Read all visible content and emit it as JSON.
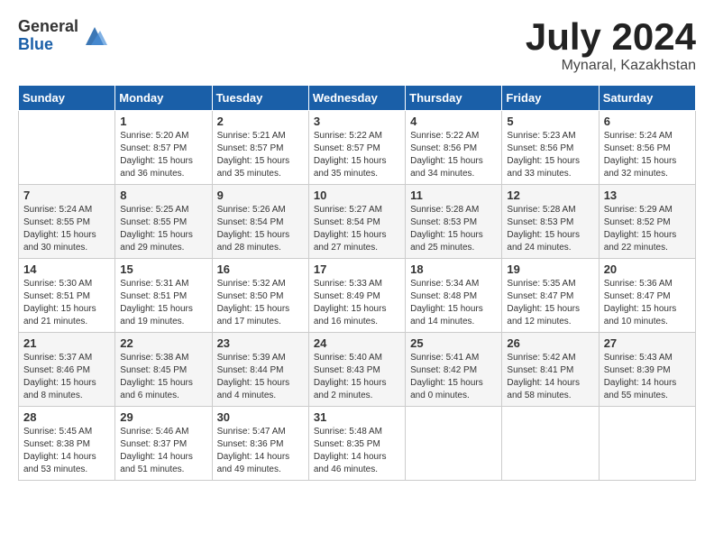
{
  "logo": {
    "general": "General",
    "blue": "Blue"
  },
  "title": "July 2024",
  "location": "Mynaral, Kazakhstan",
  "days_header": [
    "Sunday",
    "Monday",
    "Tuesday",
    "Wednesday",
    "Thursday",
    "Friday",
    "Saturday"
  ],
  "weeks": [
    [
      {
        "day": "",
        "info": ""
      },
      {
        "day": "1",
        "info": "Sunrise: 5:20 AM\nSunset: 8:57 PM\nDaylight: 15 hours\nand 36 minutes."
      },
      {
        "day": "2",
        "info": "Sunrise: 5:21 AM\nSunset: 8:57 PM\nDaylight: 15 hours\nand 35 minutes."
      },
      {
        "day": "3",
        "info": "Sunrise: 5:22 AM\nSunset: 8:57 PM\nDaylight: 15 hours\nand 35 minutes."
      },
      {
        "day": "4",
        "info": "Sunrise: 5:22 AM\nSunset: 8:56 PM\nDaylight: 15 hours\nand 34 minutes."
      },
      {
        "day": "5",
        "info": "Sunrise: 5:23 AM\nSunset: 8:56 PM\nDaylight: 15 hours\nand 33 minutes."
      },
      {
        "day": "6",
        "info": "Sunrise: 5:24 AM\nSunset: 8:56 PM\nDaylight: 15 hours\nand 32 minutes."
      }
    ],
    [
      {
        "day": "7",
        "info": "Sunrise: 5:24 AM\nSunset: 8:55 PM\nDaylight: 15 hours\nand 30 minutes."
      },
      {
        "day": "8",
        "info": "Sunrise: 5:25 AM\nSunset: 8:55 PM\nDaylight: 15 hours\nand 29 minutes."
      },
      {
        "day": "9",
        "info": "Sunrise: 5:26 AM\nSunset: 8:54 PM\nDaylight: 15 hours\nand 28 minutes."
      },
      {
        "day": "10",
        "info": "Sunrise: 5:27 AM\nSunset: 8:54 PM\nDaylight: 15 hours\nand 27 minutes."
      },
      {
        "day": "11",
        "info": "Sunrise: 5:28 AM\nSunset: 8:53 PM\nDaylight: 15 hours\nand 25 minutes."
      },
      {
        "day": "12",
        "info": "Sunrise: 5:28 AM\nSunset: 8:53 PM\nDaylight: 15 hours\nand 24 minutes."
      },
      {
        "day": "13",
        "info": "Sunrise: 5:29 AM\nSunset: 8:52 PM\nDaylight: 15 hours\nand 22 minutes."
      }
    ],
    [
      {
        "day": "14",
        "info": "Sunrise: 5:30 AM\nSunset: 8:51 PM\nDaylight: 15 hours\nand 21 minutes."
      },
      {
        "day": "15",
        "info": "Sunrise: 5:31 AM\nSunset: 8:51 PM\nDaylight: 15 hours\nand 19 minutes."
      },
      {
        "day": "16",
        "info": "Sunrise: 5:32 AM\nSunset: 8:50 PM\nDaylight: 15 hours\nand 17 minutes."
      },
      {
        "day": "17",
        "info": "Sunrise: 5:33 AM\nSunset: 8:49 PM\nDaylight: 15 hours\nand 16 minutes."
      },
      {
        "day": "18",
        "info": "Sunrise: 5:34 AM\nSunset: 8:48 PM\nDaylight: 15 hours\nand 14 minutes."
      },
      {
        "day": "19",
        "info": "Sunrise: 5:35 AM\nSunset: 8:47 PM\nDaylight: 15 hours\nand 12 minutes."
      },
      {
        "day": "20",
        "info": "Sunrise: 5:36 AM\nSunset: 8:47 PM\nDaylight: 15 hours\nand 10 minutes."
      }
    ],
    [
      {
        "day": "21",
        "info": "Sunrise: 5:37 AM\nSunset: 8:46 PM\nDaylight: 15 hours\nand 8 minutes."
      },
      {
        "day": "22",
        "info": "Sunrise: 5:38 AM\nSunset: 8:45 PM\nDaylight: 15 hours\nand 6 minutes."
      },
      {
        "day": "23",
        "info": "Sunrise: 5:39 AM\nSunset: 8:44 PM\nDaylight: 15 hours\nand 4 minutes."
      },
      {
        "day": "24",
        "info": "Sunrise: 5:40 AM\nSunset: 8:43 PM\nDaylight: 15 hours\nand 2 minutes."
      },
      {
        "day": "25",
        "info": "Sunrise: 5:41 AM\nSunset: 8:42 PM\nDaylight: 15 hours\nand 0 minutes."
      },
      {
        "day": "26",
        "info": "Sunrise: 5:42 AM\nSunset: 8:41 PM\nDaylight: 14 hours\nand 58 minutes."
      },
      {
        "day": "27",
        "info": "Sunrise: 5:43 AM\nSunset: 8:39 PM\nDaylight: 14 hours\nand 55 minutes."
      }
    ],
    [
      {
        "day": "28",
        "info": "Sunrise: 5:45 AM\nSunset: 8:38 PM\nDaylight: 14 hours\nand 53 minutes."
      },
      {
        "day": "29",
        "info": "Sunrise: 5:46 AM\nSunset: 8:37 PM\nDaylight: 14 hours\nand 51 minutes."
      },
      {
        "day": "30",
        "info": "Sunrise: 5:47 AM\nSunset: 8:36 PM\nDaylight: 14 hours\nand 49 minutes."
      },
      {
        "day": "31",
        "info": "Sunrise: 5:48 AM\nSunset: 8:35 PM\nDaylight: 14 hours\nand 46 minutes."
      },
      {
        "day": "",
        "info": ""
      },
      {
        "day": "",
        "info": ""
      },
      {
        "day": "",
        "info": ""
      }
    ]
  ]
}
